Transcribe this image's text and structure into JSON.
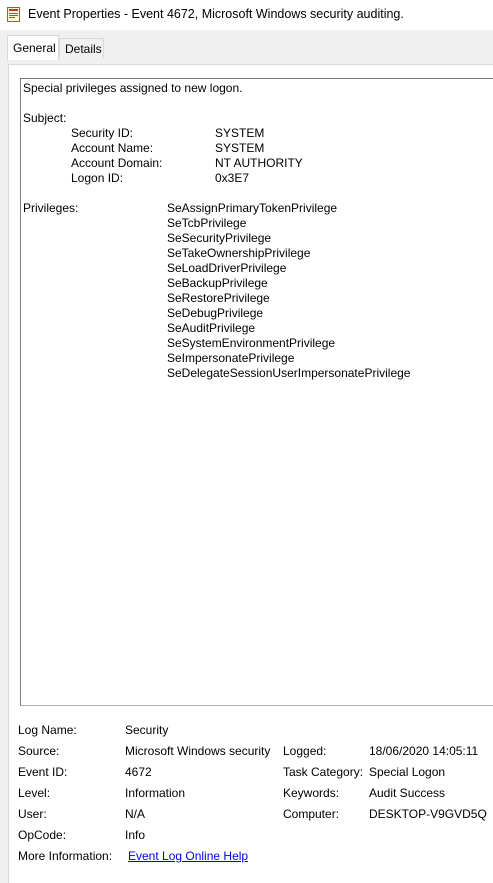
{
  "window": {
    "title": "Event Properties - Event 4672, Microsoft Windows security auditing."
  },
  "tabs": [
    {
      "label": "General",
      "active": true
    },
    {
      "label": "Details",
      "active": false
    }
  ],
  "description": {
    "summary": "Special privileges assigned to new logon.",
    "subject_heading": "Subject:",
    "subject_fields": [
      {
        "label": "Security ID:",
        "value": "SYSTEM"
      },
      {
        "label": "Account Name:",
        "value": "SYSTEM"
      },
      {
        "label": "Account Domain:",
        "value": "NT AUTHORITY"
      },
      {
        "label": "Logon ID:",
        "value": "0x3E7"
      }
    ],
    "privileges_heading": "Privileges:",
    "privileges": [
      "SeAssignPrimaryTokenPrivilege",
      "SeTcbPrivilege",
      "SeSecurityPrivilege",
      "SeTakeOwnershipPrivilege",
      "SeLoadDriverPrivilege",
      "SeBackupPrivilege",
      "SeRestorePrivilege",
      "SeDebugPrivilege",
      "SeAuditPrivilege",
      "SeSystemEnvironmentPrivilege",
      "SeImpersonatePrivilege",
      "SeDelegateSessionUserImpersonatePrivilege"
    ]
  },
  "properties": {
    "log_name_label": "Log Name:",
    "log_name": "Security",
    "source_label": "Source:",
    "source": "Microsoft Windows security",
    "logged_label": "Logged:",
    "logged": "18/06/2020 14:05:11",
    "event_id_label": "Event ID:",
    "event_id": "4672",
    "task_category_label": "Task Category:",
    "task_category": "Special Logon",
    "level_label": "Level:",
    "level": "Information",
    "keywords_label": "Keywords:",
    "keywords": "Audit Success",
    "user_label": "User:",
    "user": "N/A",
    "computer_label": "Computer:",
    "computer": "DESKTOP-V9GVD5Q",
    "opcode_label": "OpCode:",
    "opcode": "Info",
    "more_info_label": "More Information:",
    "more_info_link": "Event Log Online Help"
  },
  "colors": {
    "link": "#0000ee",
    "panel_bg": "#f0f0f0"
  },
  "icons": {
    "title": "event-properties-icon"
  }
}
